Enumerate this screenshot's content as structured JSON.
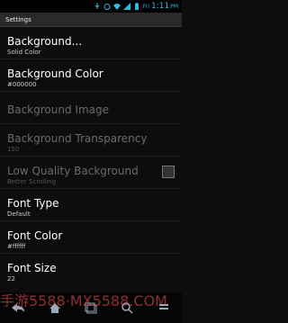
{
  "status_bar": {
    "time": "1:11",
    "icons": [
      "usb-icon",
      "alarm-icon",
      "wifi-icon",
      "signal-icon",
      "battery-icon"
    ],
    "am_pm": "PM",
    "day": "Fri"
  },
  "title": "Settings",
  "items": [
    {
      "label": "Background...",
      "summary": "Solid Color",
      "enabled": true
    },
    {
      "label": "Background Color",
      "summary": "#000000",
      "enabled": true
    },
    {
      "label": "Background Image",
      "summary": "",
      "enabled": false
    },
    {
      "label": "Background Transparency",
      "summary": "150",
      "enabled": false
    },
    {
      "label": "Low Quality Background",
      "summary": "Better Scrolling",
      "enabled": false,
      "checkbox": false
    },
    {
      "label": "Font Type",
      "summary": "Default",
      "enabled": true
    },
    {
      "label": "Font Color",
      "summary": "#ffffff",
      "enabled": true
    },
    {
      "label": "Font Size",
      "summary": "22",
      "enabled": true
    }
  ],
  "watermark": "手游5588·MX5588.COM",
  "colors": {
    "accent": "#33b5e5",
    "background": "#0d0d0d",
    "disabled_text": "#6b6b6b"
  }
}
